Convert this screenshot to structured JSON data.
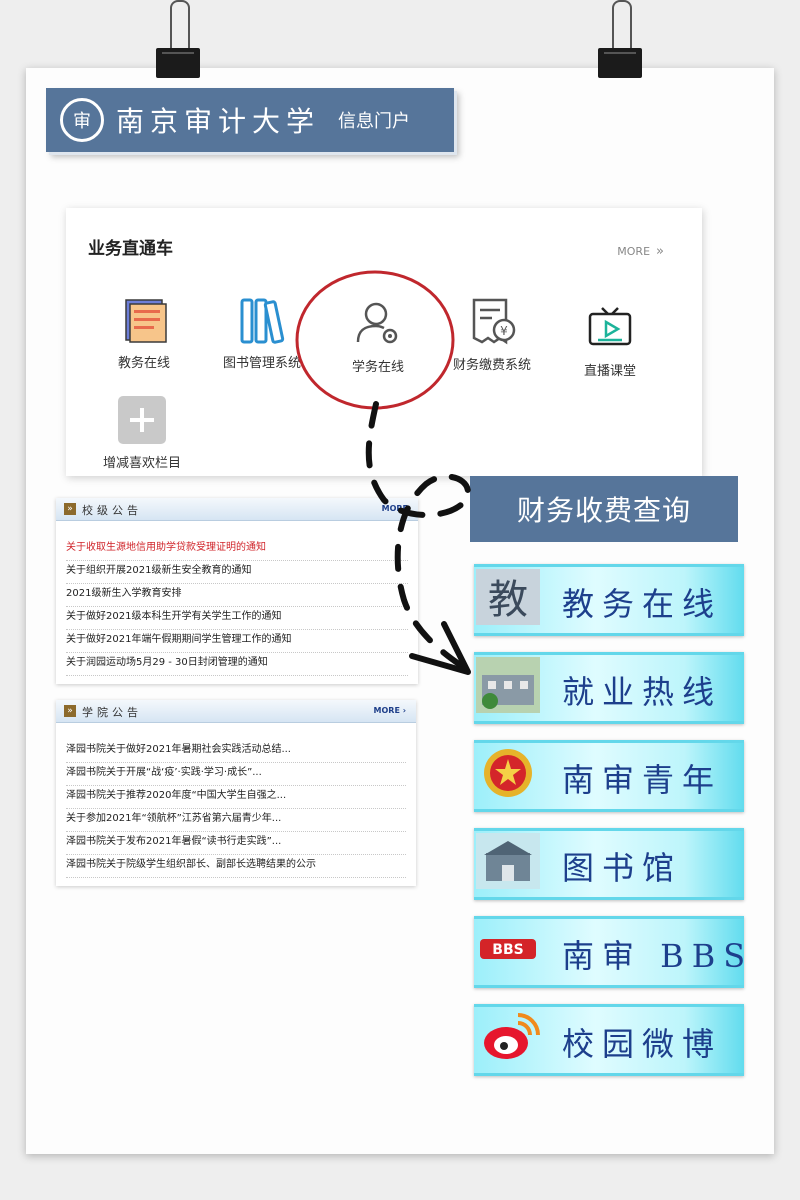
{
  "header": {
    "school": "南京审计大学",
    "portal": "信息门户"
  },
  "express": {
    "title": "业务直通车",
    "more": "MORE",
    "tiles": [
      {
        "label": "教务在线",
        "icon": "book-icon"
      },
      {
        "label": "图书管理系统",
        "icon": "books-icon"
      },
      {
        "label": "学务在线",
        "icon": "user-gear-icon"
      },
      {
        "label": "财务缴费系统",
        "icon": "receipt-yen-icon"
      },
      {
        "label": "直播课堂",
        "icon": "tv-play-icon"
      },
      {
        "label": "增减喜欢栏目",
        "icon": "plus-icon"
      }
    ]
  },
  "school_notices": {
    "title": "校级公告",
    "more": "MORE",
    "items": [
      "关于收取生源地信用助学贷款受理证明的通知",
      "关于组织开展2021级新生安全教育的通知",
      "2021级新生入学教育安排",
      "关于做好2021级本科生开学有关学生工作的通知",
      "关于做好2021年端午假期期间学生管理工作的通知",
      "关于润园运动场5月29 - 30日封闭管理的通知"
    ]
  },
  "college_notices": {
    "title": "学院公告",
    "more": "MORE ›",
    "items": [
      "泽园书院关于做好2021年暑期社会实践活动总结...",
      "泽园书院关于开展“战‘疫’·实践·学习·成长”...",
      "泽园书院关于推荐2020年度“中国大学生自强之...",
      "关于参加2021年“领航杯”江苏省第六届青少年...",
      "泽园书院关于发布2021年暑假“读书行走实践”...",
      "泽园书院关于院级学生组织部长、副部长选聘结果的公示"
    ]
  },
  "quick_links": {
    "title": "财务收费查询",
    "items": [
      {
        "label": "教务在线",
        "icon": "calligraphy-icon"
      },
      {
        "label": "就业热线",
        "icon": "campus-building-icon"
      },
      {
        "label": "南审青年",
        "icon": "youth-league-badge-icon"
      },
      {
        "label": "图书馆",
        "icon": "library-building-icon"
      },
      {
        "label": "南审 BBS",
        "icon": "bbs-logo-icon"
      },
      {
        "label": "校园微博",
        "icon": "weibo-icon"
      }
    ]
  },
  "colors": {
    "header_blue": "#56759a",
    "hot_red": "#d0242a",
    "link_text": "#1d3f8c",
    "annotation_red": "#c0272d"
  }
}
